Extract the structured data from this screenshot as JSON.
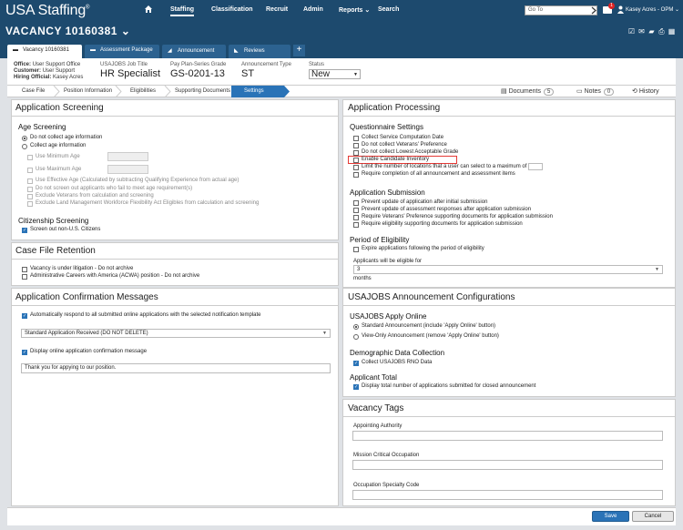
{
  "app": {
    "logo": "USA Staffing",
    "logo_mark": "®"
  },
  "topnav": {
    "items": [
      "Staffing",
      "Classification",
      "Recruit",
      "Admin",
      "Reports",
      "Search"
    ],
    "goto_placeholder": "Go To",
    "mail_count": "1",
    "user_name": "Kasey Acres - OPM"
  },
  "vacancy": {
    "title": "VACANCY 10160381",
    "chevron": "⌄"
  },
  "tabs": [
    {
      "label": "Vacancy 10160381"
    },
    {
      "label": "Assessment Package"
    },
    {
      "label": "Announcement"
    },
    {
      "label": "Reviews"
    }
  ],
  "tab_add": "+",
  "info": {
    "office_label": "Office:",
    "office_value": "User Support Office",
    "customer_label": "Customer:",
    "customer_value": "User Support",
    "hiring_label": "Hiring Official:",
    "hiring_value": "Kasey Acres",
    "job_title_label": "USAJOBS Job Title",
    "job_title_value": "HR Specialist",
    "grade_label": "Pay Plan-Series Grade",
    "grade_value": "GS-0201-13",
    "ann_type_label": "Announcement Type",
    "ann_type_value": "ST",
    "status_label": "Status",
    "status_value": "New"
  },
  "breadcrumbs": [
    "Case File",
    "Position Information",
    "Eligibilities",
    "Supporting Documents",
    "Settings"
  ],
  "tools": {
    "documents": "Documents",
    "documents_count": "5",
    "notes": "Notes",
    "notes_count": "0",
    "history": "History"
  },
  "app_screening": {
    "title": "Application Screening",
    "age_title": "Age Screening",
    "radio1": "Do not collect age information",
    "radio2": "Collect age information",
    "min_age": "Use Minimum Age",
    "max_age": "Use Maximum Age",
    "eff_age": "Use Effective Age (Calculated by subtracting Qualifying Experience from actual age)",
    "no_screen": "Do not screen out applicants who fail to meet age requirement(s)",
    "exclude_vet": "Exclude Veterans from calculation and screening",
    "exclude_lmw": "Exclude Land Management Workforce Flexibility Act Eligibles from calculation and screening",
    "cit_title": "Citizenship Screening",
    "cit_opt": "Screen out non-U.S. Citizens"
  },
  "case_file": {
    "title": "Case File Retention",
    "opt1": "Vacancy is under litigation - Do not archive",
    "opt2": "Administrative Careers with America (ACWA) position - Do not archive"
  },
  "confirm": {
    "title": "Application Confirmation Messages",
    "opt1": "Automatically respond to all submitted online applications with the selected notification template",
    "template": "Standard Application Received (DO NOT DELETE)",
    "opt2": "Display online application confirmation message",
    "message": "Thank you for appying to our position."
  },
  "processing": {
    "title": "Application Processing",
    "q_title": "Questionnaire Settings",
    "q1": "Collect Service Computation Date",
    "q2": "Do not collect Veterans' Preference",
    "q3": "Do not collect Lowest Acceptable Grade",
    "q4": "Enable Candidate Inventory",
    "q5": "Limit the number of locations that a user can select to a maximum of",
    "q6": "Require completion of all announcement and assessment items",
    "sub_title": "Application Submission",
    "s1": "Prevent update of application after initial submission",
    "s2": "Prevent update of assessment responses after application submission",
    "s3": "Require Veterans' Preference supporting documents for application submission",
    "s4": "Require eligibility supporting documents for application submission",
    "pe_title": "Period of Eligibility",
    "pe1": "Expire applications following the period of eligibility",
    "pe_label": "Applicants will be eligible for",
    "pe_value": "3",
    "pe_unit": "months"
  },
  "usajobs": {
    "title": "USAJOBS Announcement Configurations",
    "apply_title": "USAJOBS Apply Online",
    "a1": "Standard Announcement (include 'Apply Online' button)",
    "a2": "View-Only Announcement (remove 'Apply Online' button)",
    "demo_title": "Demographic Data Collection",
    "d1": "Collect USAJOBS RNO Data",
    "total_title": "Applicant Total",
    "t1": "Display total number of applications submitted for closed announcement"
  },
  "tags": {
    "title": "Vacancy Tags",
    "f1": "Appointing Authority",
    "f2": "Mission Critical Occupation",
    "f3": "Occupation Specialty Code"
  },
  "footer": {
    "save": "Save",
    "cancel": "Cancel"
  },
  "colors": {
    "header": "#1d4a6e",
    "tab": "#2c6290",
    "accent": "#2a73b7",
    "highlight": "#e53935"
  }
}
